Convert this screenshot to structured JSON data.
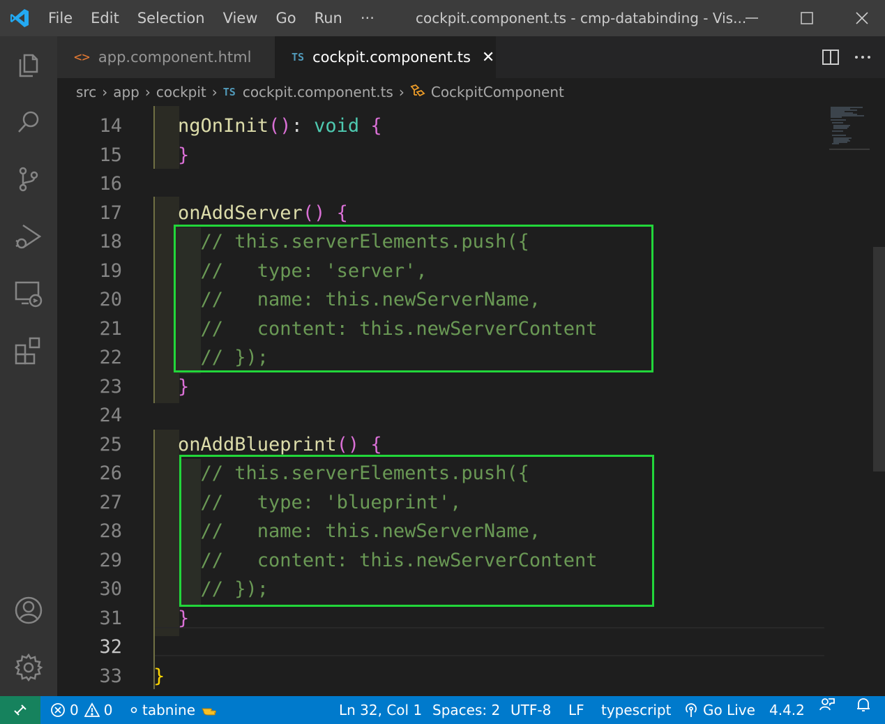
{
  "titlebar": {
    "menu": [
      "File",
      "Edit",
      "Selection",
      "View",
      "Go",
      "Run",
      "···"
    ],
    "title": "cockpit.component.ts - cmp-databinding - Vis...",
    "minimize": "—",
    "maximize": "□",
    "close": "✕"
  },
  "activity_icons": [
    "explorer-icon",
    "search-icon",
    "source-control-icon",
    "run-debug-icon",
    "remote-explorer-icon",
    "extensions-icon",
    "accounts-icon",
    "settings-gear-icon"
  ],
  "tabs": [
    {
      "label": "app.component.html",
      "badge": "<>",
      "active": false
    },
    {
      "label": "cockpit.component.ts",
      "badge": "TS",
      "active": true,
      "close": "✕"
    }
  ],
  "breadcrumb": {
    "items": [
      "src",
      "app",
      "cockpit"
    ],
    "file_badge": "TS",
    "file": "cockpit.component.ts",
    "symbol": "CockpitComponent",
    "sep": "›"
  },
  "editor": {
    "lines": [
      {
        "n": "14",
        "tokens": [
          [
            "fn",
            "ngOnInit"
          ],
          [
            "br1",
            "()"
          ],
          [
            "punc",
            ": "
          ],
          [
            "kw",
            "void"
          ],
          [
            "punc",
            " "
          ],
          [
            "br1",
            "{"
          ]
        ]
      },
      {
        "n": "15",
        "tokens": [
          [
            "br1",
            "}"
          ]
        ]
      },
      {
        "n": "16",
        "tokens": []
      },
      {
        "n": "17",
        "tokens": [
          [
            "fn",
            "onAddServer"
          ],
          [
            "br1",
            "()"
          ],
          [
            "punc",
            " "
          ],
          [
            "br1",
            "{"
          ]
        ]
      },
      {
        "n": "18",
        "tokens": [
          [
            "punc",
            "  "
          ],
          [
            "comment",
            "// this.serverElements.push({"
          ]
        ]
      },
      {
        "n": "19",
        "tokens": [
          [
            "punc",
            "  "
          ],
          [
            "comment",
            "//   type: 'server',"
          ]
        ]
      },
      {
        "n": "20",
        "tokens": [
          [
            "punc",
            "  "
          ],
          [
            "comment",
            "//   name: this.newServerName,"
          ]
        ]
      },
      {
        "n": "21",
        "tokens": [
          [
            "punc",
            "  "
          ],
          [
            "comment",
            "//   content: this.newServerContent"
          ]
        ]
      },
      {
        "n": "22",
        "tokens": [
          [
            "punc",
            "  "
          ],
          [
            "comment",
            "// });"
          ]
        ]
      },
      {
        "n": "23",
        "tokens": [
          [
            "br1",
            "}"
          ]
        ]
      },
      {
        "n": "24",
        "tokens": []
      },
      {
        "n": "25",
        "tokens": [
          [
            "fn",
            "onAddBlueprint"
          ],
          [
            "br1",
            "()"
          ],
          [
            "punc",
            " "
          ],
          [
            "br1",
            "{"
          ]
        ]
      },
      {
        "n": "26",
        "tokens": [
          [
            "punc",
            "  "
          ],
          [
            "comment",
            "// this.serverElements.push({"
          ]
        ]
      },
      {
        "n": "27",
        "tokens": [
          [
            "punc",
            "  "
          ],
          [
            "comment",
            "//   type: 'blueprint',"
          ]
        ]
      },
      {
        "n": "28",
        "tokens": [
          [
            "punc",
            "  "
          ],
          [
            "comment",
            "//   name: this.newServerName,"
          ]
        ]
      },
      {
        "n": "29",
        "tokens": [
          [
            "punc",
            "  "
          ],
          [
            "comment",
            "//   content: this.newServerContent"
          ]
        ]
      },
      {
        "n": "30",
        "tokens": [
          [
            "punc",
            "  "
          ],
          [
            "comment",
            "// });"
          ]
        ]
      },
      {
        "n": "31",
        "tokens": [
          [
            "br1",
            "}"
          ]
        ]
      },
      {
        "n": "32",
        "tokens": [],
        "current": true
      },
      {
        "n": "33",
        "tokens": [
          [
            "br2",
            "}"
          ]
        ],
        "outer": true
      }
    ]
  },
  "statusbar": {
    "errors": "0",
    "warnings": "0",
    "tabnine": "tabnine",
    "position": "Ln 32, Col 1",
    "spaces": "Spaces: 2",
    "encoding": "UTF-8",
    "eol": "LF",
    "language": "typescript",
    "golive": "Go Live",
    "version": "4.4.2"
  },
  "colors": {
    "statusbar": "#007acc",
    "remote": "#16825d",
    "highlight_box": "#22d63a"
  }
}
